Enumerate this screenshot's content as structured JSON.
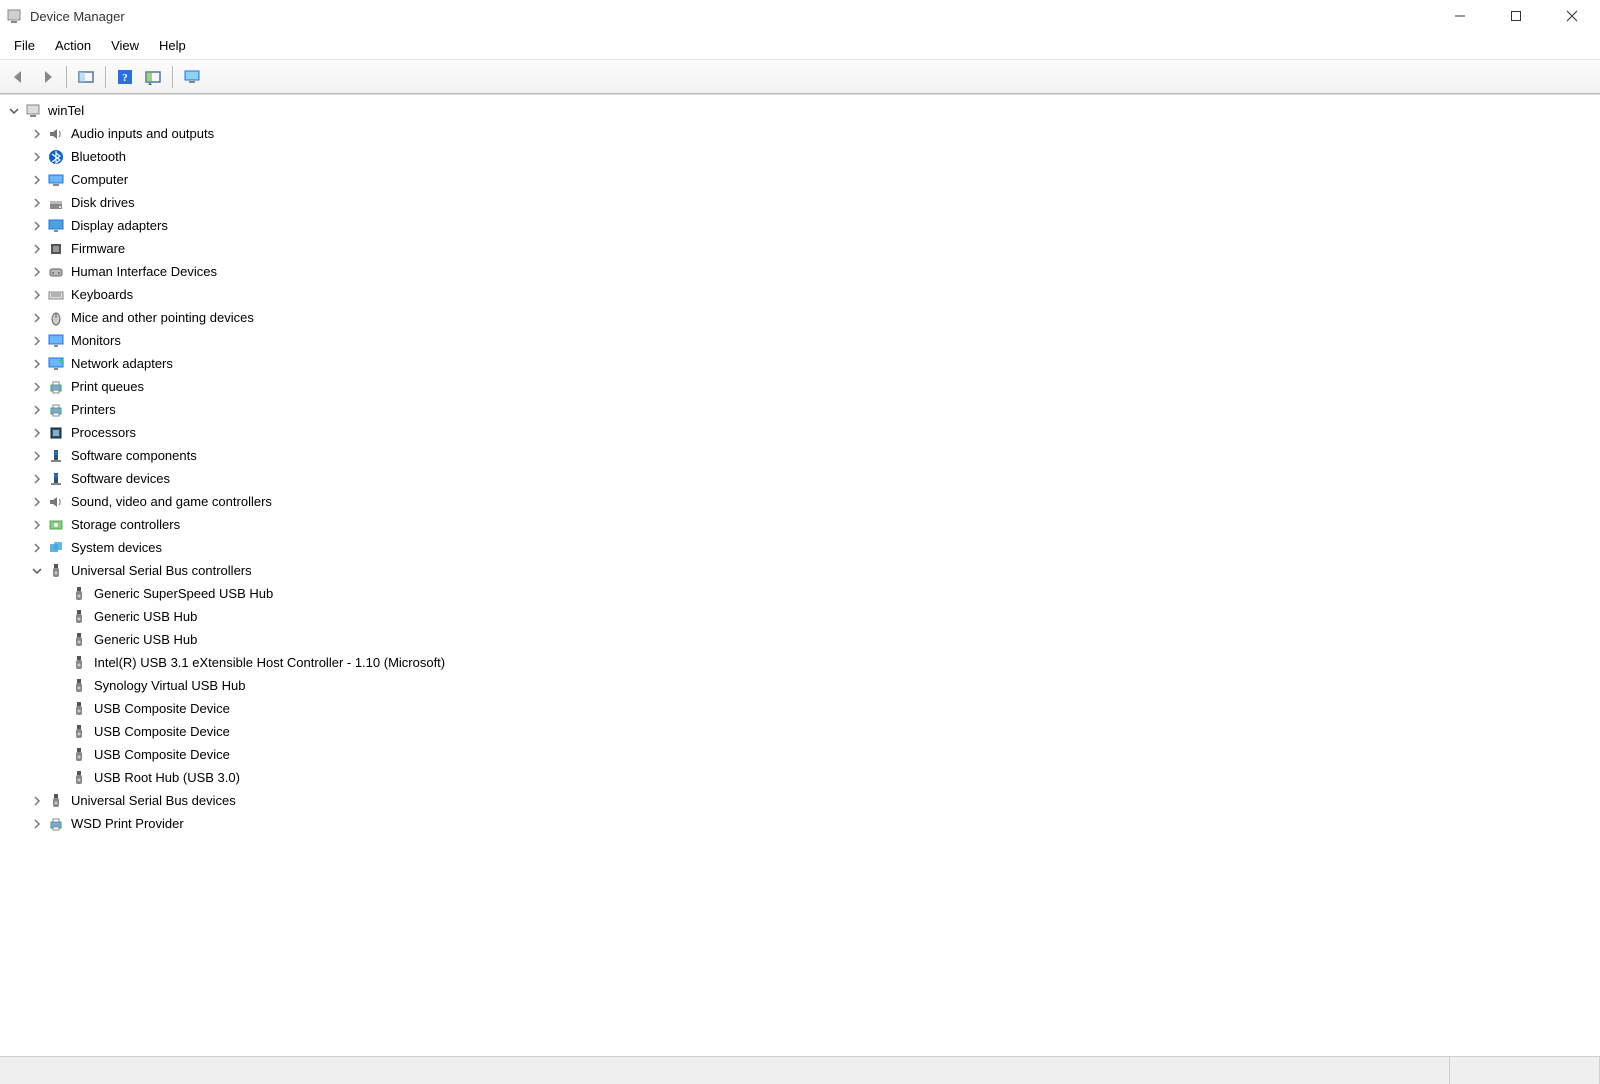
{
  "window": {
    "title": "Device Manager"
  },
  "menu": [
    "File",
    "Action",
    "View",
    "Help"
  ],
  "toolbar": {
    "back": "back-icon",
    "forward": "forward-icon",
    "properties": "properties-icon",
    "help": "help-icon",
    "scan": "scan-icon",
    "monitor": "monitor-icon"
  },
  "tree": {
    "root": {
      "label": "winTel",
      "expanded": true,
      "icon": "computer-root-icon"
    },
    "categories": [
      {
        "label": "Audio inputs and outputs",
        "icon": "speaker-icon",
        "expanded": false
      },
      {
        "label": "Bluetooth",
        "icon": "bluetooth-icon",
        "expanded": false
      },
      {
        "label": "Computer",
        "icon": "computer-icon",
        "expanded": false
      },
      {
        "label": "Disk drives",
        "icon": "disk-icon",
        "expanded": false
      },
      {
        "label": "Display adapters",
        "icon": "display-icon",
        "expanded": false
      },
      {
        "label": "Firmware",
        "icon": "firmware-icon",
        "expanded": false
      },
      {
        "label": "Human Interface Devices",
        "icon": "hid-icon",
        "expanded": false
      },
      {
        "label": "Keyboards",
        "icon": "keyboard-icon",
        "expanded": false
      },
      {
        "label": "Mice and other pointing devices",
        "icon": "mouse-icon",
        "expanded": false
      },
      {
        "label": "Monitors",
        "icon": "monitor-cat-icon",
        "expanded": false
      },
      {
        "label": "Network adapters",
        "icon": "network-icon",
        "expanded": false
      },
      {
        "label": "Print queues",
        "icon": "printer-icon",
        "expanded": false
      },
      {
        "label": "Printers",
        "icon": "printer-icon",
        "expanded": false
      },
      {
        "label": "Processors",
        "icon": "cpu-icon",
        "expanded": false
      },
      {
        "label": "Software components",
        "icon": "software-icon",
        "expanded": false
      },
      {
        "label": "Software devices",
        "icon": "software-icon",
        "expanded": false
      },
      {
        "label": "Sound, video and game controllers",
        "icon": "speaker-icon",
        "expanded": false
      },
      {
        "label": "Storage controllers",
        "icon": "storage-icon",
        "expanded": false
      },
      {
        "label": "System devices",
        "icon": "system-icon",
        "expanded": false
      },
      {
        "label": "Universal Serial Bus controllers",
        "icon": "usb-icon",
        "expanded": true,
        "children": [
          {
            "label": "Generic SuperSpeed USB Hub",
            "icon": "usb-icon"
          },
          {
            "label": "Generic USB Hub",
            "icon": "usb-icon"
          },
          {
            "label": "Generic USB Hub",
            "icon": "usb-icon"
          },
          {
            "label": "Intel(R) USB 3.1 eXtensible Host Controller - 1.10 (Microsoft)",
            "icon": "usb-icon"
          },
          {
            "label": "Synology Virtual USB Hub",
            "icon": "usb-icon"
          },
          {
            "label": "USB Composite Device",
            "icon": "usb-icon"
          },
          {
            "label": "USB Composite Device",
            "icon": "usb-icon"
          },
          {
            "label": "USB Composite Device",
            "icon": "usb-icon"
          },
          {
            "label": "USB Root Hub (USB 3.0)",
            "icon": "usb-icon"
          }
        ]
      },
      {
        "label": "Universal Serial Bus devices",
        "icon": "usb-icon",
        "expanded": false
      },
      {
        "label": "WSD Print Provider",
        "icon": "printer-icon",
        "expanded": false
      }
    ]
  }
}
